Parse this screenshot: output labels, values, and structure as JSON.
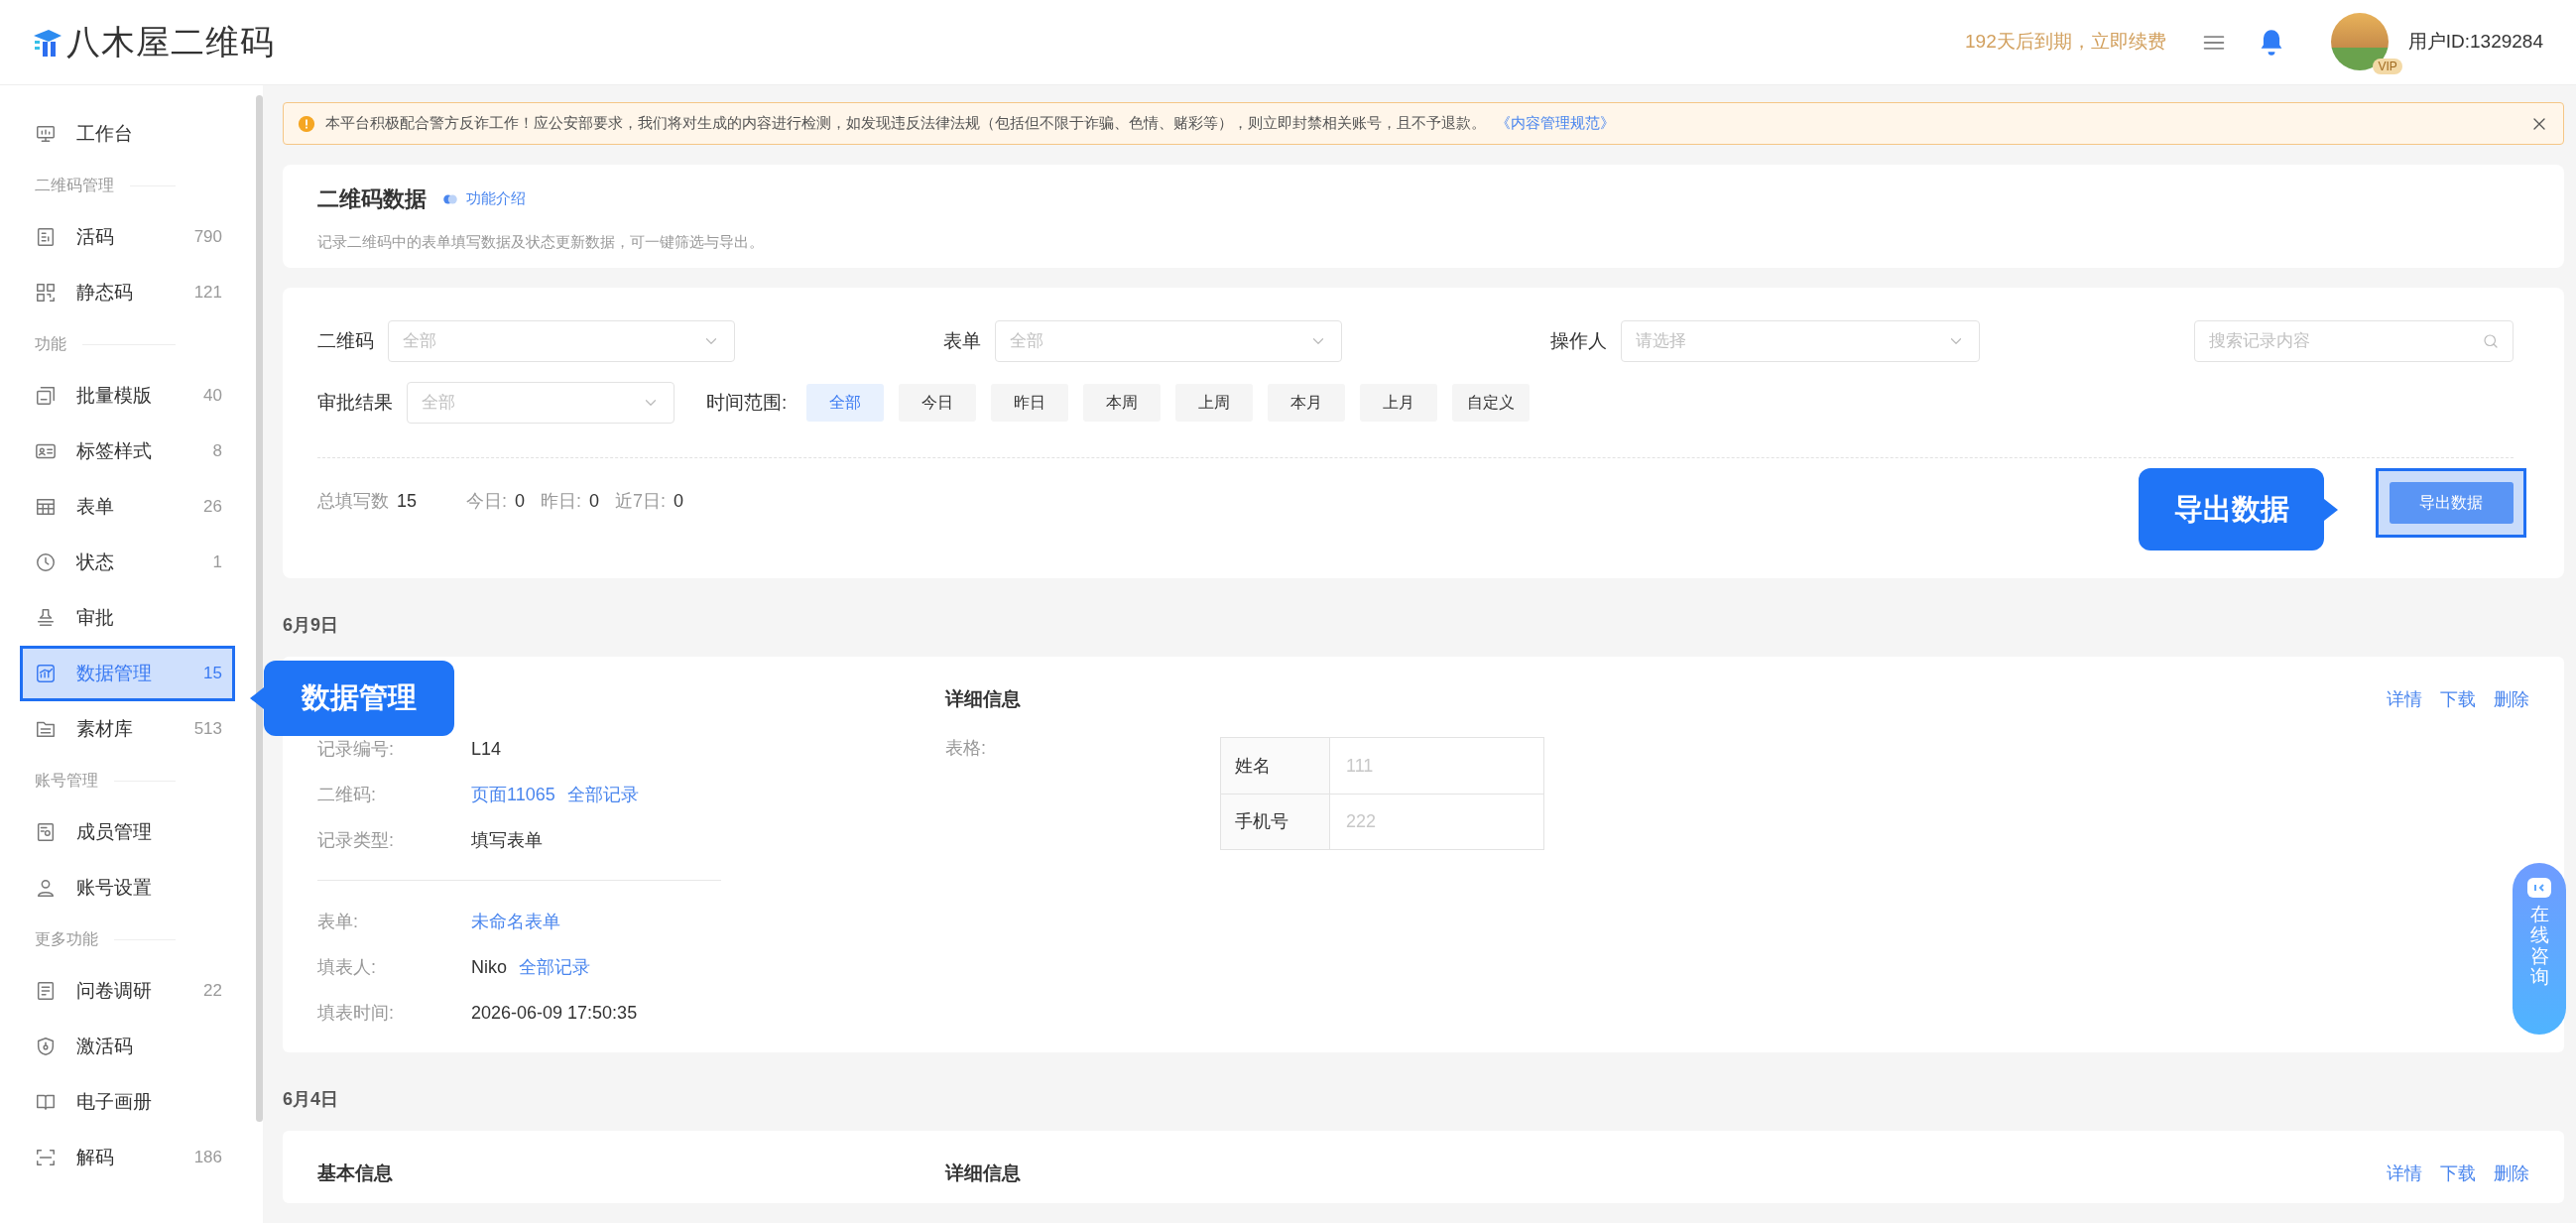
{
  "header": {
    "logo_text": "八木屋二维码",
    "renewal": "192天后到期，立即续费",
    "vip_badge": "VIP",
    "user_id": "用户ID:1329284"
  },
  "sidebar": {
    "groups": [
      {
        "items": [
          {
            "label": "工作台",
            "selected": false
          }
        ]
      },
      {
        "title": "二维码管理",
        "items": [
          {
            "label": "活码",
            "count": "790",
            "selected": false
          },
          {
            "label": "静态码",
            "count": "121",
            "selected": false
          }
        ]
      },
      {
        "title": "功能",
        "items": [
          {
            "label": "批量模版",
            "count": "40",
            "selected": false
          },
          {
            "label": "标签样式",
            "count": "8",
            "selected": false
          },
          {
            "label": "表单",
            "count": "26",
            "selected": false
          },
          {
            "label": "状态",
            "count": "1",
            "selected": false
          },
          {
            "label": "审批",
            "selected": false
          },
          {
            "label": "数据管理",
            "count": "15",
            "selected": true
          },
          {
            "label": "素材库",
            "count": "513",
            "selected": false
          }
        ]
      },
      {
        "title": "账号管理",
        "items": [
          {
            "label": "成员管理",
            "selected": false
          },
          {
            "label": "账号设置",
            "selected": false
          }
        ]
      },
      {
        "title": "更多功能",
        "items": [
          {
            "label": "问卷调研",
            "count": "22",
            "selected": false
          },
          {
            "label": "激活码",
            "selected": false
          },
          {
            "label": "电子画册",
            "selected": false
          },
          {
            "label": "解码",
            "count": "186",
            "selected": false
          }
        ]
      }
    ]
  },
  "notice": {
    "text": "本平台积极配合警方反诈工作！应公安部要求，我们将对生成的内容进行检测，如发现违反法律法规（包括但不限于诈骗、色情、赌彩等），则立即封禁相关账号，且不予退款。",
    "link": "《内容管理规范》"
  },
  "page_header": {
    "title": "二维码数据",
    "help_link": "功能介绍",
    "description": "记录二维码中的表单填写数据及状态更新数据，可一键筛选与导出。"
  },
  "filters": {
    "selects": [
      {
        "label": "二维码",
        "placeholder": "全部"
      },
      {
        "label": "表单",
        "placeholder": "全部"
      },
      {
        "label": "操作人",
        "placeholder": "请选择"
      }
    ],
    "search": {
      "placeholder": "搜索记录内容"
    },
    "approval": {
      "label": "审批结果",
      "placeholder": "全部"
    },
    "time_range": {
      "label": "时间范围:",
      "options": [
        {
          "label": "全部",
          "selected": true
        },
        {
          "label": "今日",
          "selected": false
        },
        {
          "label": "昨日",
          "selected": false
        },
        {
          "label": "本周",
          "selected": false
        },
        {
          "label": "上周",
          "selected": false
        },
        {
          "label": "本月",
          "selected": false
        },
        {
          "label": "上月",
          "selected": false
        },
        {
          "label": "自定义",
          "selected": false
        }
      ]
    }
  },
  "stats": {
    "total_label": "总填写数",
    "total": "15",
    "items": [
      {
        "label": "今日:",
        "value": "0"
      },
      {
        "label": "昨日:",
        "value": "0"
      },
      {
        "label": "近7日:",
        "value": "0"
      }
    ]
  },
  "export_button": "导出数据",
  "callouts": {
    "export": "导出数据",
    "sidebar": "数据管理"
  },
  "record_groups": [
    {
      "date": "6月9日",
      "records": [
        {
          "detail_title": "详细信息",
          "actions": [
            "详情",
            "下载",
            "删除"
          ],
          "field_groups": [
            [
              {
                "label": "记录编号:",
                "parts": [
                  {
                    "kind": "text",
                    "text": "L14"
                  }
                ]
              },
              {
                "label": "二维码:",
                "parts": [
                  {
                    "kind": "link",
                    "text": "页面11065"
                  },
                  {
                    "kind": "link",
                    "text": "全部记录"
                  }
                ]
              },
              {
                "label": "记录类型:",
                "parts": [
                  {
                    "kind": "text",
                    "text": "填写表单"
                  }
                ]
              }
            ],
            [
              {
                "label": "表单:",
                "parts": [
                  {
                    "kind": "link",
                    "text": "未命名表单"
                  }
                ]
              },
              {
                "label": "填表人:",
                "parts": [
                  {
                    "kind": "text",
                    "text": "Niko"
                  },
                  {
                    "kind": "link",
                    "text": "全部记录"
                  }
                ]
              },
              {
                "label": "填表时间:",
                "parts": [
                  {
                    "kind": "text",
                    "text": "2026-06-09 17:50:35"
                  }
                ]
              }
            ]
          ],
          "detail_label": "表格:",
          "table": [
            [
              "姓名",
              "111"
            ],
            [
              "手机号",
              "222"
            ]
          ]
        }
      ]
    },
    {
      "date": "6月4日",
      "records": [
        {
          "basic_title": "基本信息",
          "detail_title": "详细信息",
          "actions": [
            "详情",
            "下载",
            "删除"
          ]
        }
      ]
    }
  ],
  "chat_widget": "在线咨询"
}
